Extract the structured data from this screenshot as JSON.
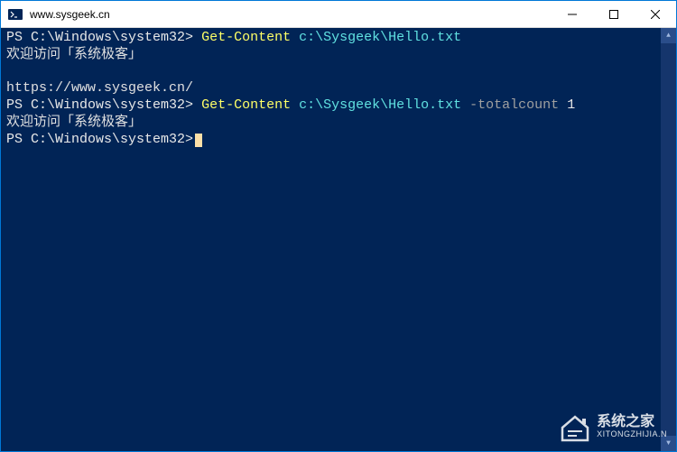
{
  "window": {
    "title": "www.sysgeek.cn"
  },
  "terminal": {
    "lines": [
      {
        "type": "cmd",
        "prompt": "PS C:\\Windows\\system32>",
        "cmdlet": "Get-Content",
        "args": "c:\\Sysgeek\\Hello.txt",
        "param": "",
        "paramval": ""
      },
      {
        "type": "out",
        "text": "欢迎访问「系统极客」"
      },
      {
        "type": "out",
        "text": ""
      },
      {
        "type": "out",
        "text": "https://www.sysgeek.cn/"
      },
      {
        "type": "cmd",
        "prompt": "PS C:\\Windows\\system32>",
        "cmdlet": "Get-Content",
        "args": "c:\\Sysgeek\\Hello.txt",
        "param": "-totalcount",
        "paramval": "1"
      },
      {
        "type": "out",
        "text": "欢迎访问「系统极客」"
      },
      {
        "type": "cmd",
        "prompt": "PS C:\\Windows\\system32>",
        "cmdlet": "",
        "args": "",
        "param": "",
        "paramval": "",
        "cursor": true
      }
    ]
  },
  "watermark": {
    "title": "系统之家",
    "url": "XITONGZHIJIA.N"
  }
}
